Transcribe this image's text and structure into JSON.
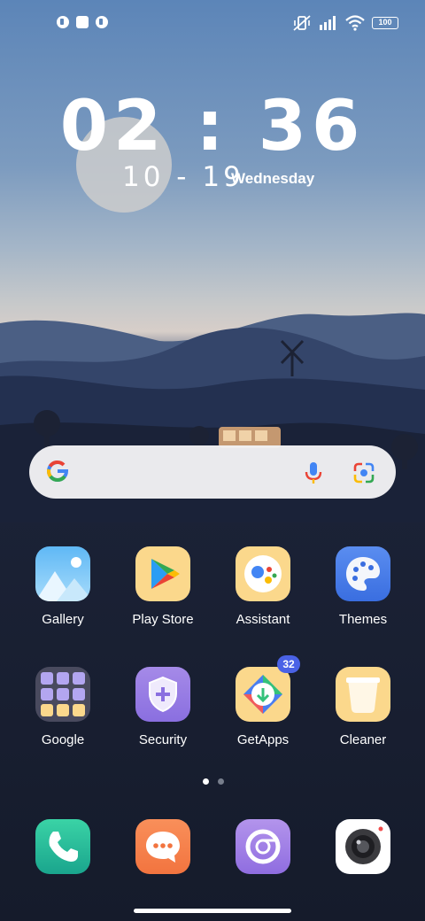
{
  "status_bar": {
    "battery": "100"
  },
  "lock_clock": {
    "time": "02 : 36",
    "date": "10 - 19",
    "weekday": "Wednesday"
  },
  "search_widget": {
    "logo_icon": "google-g-icon",
    "mic_icon": "mic-icon",
    "lens_icon": "lens-icon"
  },
  "apps_row1": [
    {
      "label": "Gallery"
    },
    {
      "label": "Play Store"
    },
    {
      "label": "Assistant"
    },
    {
      "label": "Themes"
    }
  ],
  "apps_row2": [
    {
      "label": "Google"
    },
    {
      "label": "Security"
    },
    {
      "label": "GetApps",
      "badge": "32"
    },
    {
      "label": "Cleaner"
    }
  ],
  "page_indicator": {
    "pages": 2,
    "current": 1
  },
  "dock": [
    {
      "icon": "phone-icon"
    },
    {
      "icon": "messages-icon"
    },
    {
      "icon": "browser-icon"
    },
    {
      "icon": "camera-icon"
    }
  ],
  "colors": {
    "badge": "#4a62e6",
    "sky_top": "#5c85b8"
  }
}
